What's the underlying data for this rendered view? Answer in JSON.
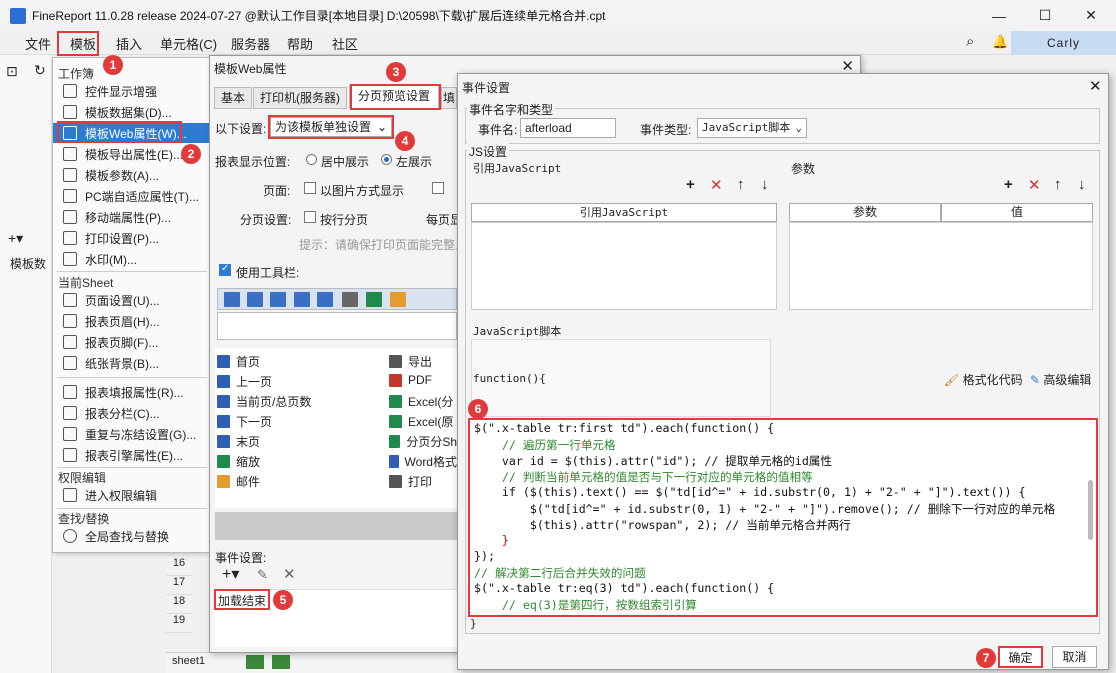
{
  "app": {
    "title": "FineReport 11.0.28 release 2024-07-27 @默认工作目录[本地目录]    D:\\20598\\下载\\扩展后连续单元格合并.cpt",
    "window_controls": [
      "—",
      "☐",
      "✕"
    ],
    "user": "Carly"
  },
  "menubar": [
    "文件",
    "模板",
    "插入",
    "单元格(C)",
    "服务器",
    "帮助",
    "社区"
  ],
  "left_panel": {
    "section": "模板数",
    "rows": [
      "16",
      "17",
      "18",
      "19"
    ],
    "sheet_tab": "sheet1"
  },
  "template_menu": {
    "sections": {
      "workbook": "工作簿",
      "current_sheet": "当前Sheet",
      "permission": "权限编辑",
      "find": "查找/替换"
    },
    "items_workbook": [
      "控件显示增强",
      "模板数据集(D)...",
      "模板Web属性(W)...",
      "模板导出属性(E)...",
      "模板参数(A)...",
      "PC端自适应属性(T)...",
      "移动端属性(P)...",
      "打印设置(P)...",
      "水印(M)..."
    ],
    "items_sheet": [
      "页面设置(U)...",
      "报表页眉(H)...",
      "报表页脚(F)...",
      "纸张背景(B)...",
      "报表填报属性(R)...",
      "报表分栏(C)...",
      "重复与冻结设置(G)...",
      "报表引擎属性(E)..."
    ],
    "items_permission": [
      "进入权限编辑"
    ],
    "items_find": [
      "全局查找与替换"
    ]
  },
  "web_dialog": {
    "title": "模板Web属性",
    "tabs": [
      "基本",
      "打印机(服务器)",
      "分页预览设置",
      "填"
    ],
    "settings_label": "以下设置:",
    "settings_value": "为该模板单独设置",
    "display_pos_label": "报表显示位置:",
    "center": "居中展示",
    "left": "左展示",
    "page_label": "页面:",
    "as_image": "以图片方式显示",
    "paging_label": "分页设置:",
    "by_row": "按行分页",
    "per_page": "每页显",
    "hint": "提示：请确保打印页面能完整显",
    "use_toolbar": "使用工具栏:",
    "buttons_left": [
      "首页",
      "上一页",
      "当前页/总页数",
      "下一页",
      "末页",
      "缩放",
      "邮件"
    ],
    "buttons_right": [
      "导出",
      "PDF",
      "Excel(分",
      "Excel(原",
      "分页分Sh",
      "Word格式",
      "打印"
    ],
    "event_label": "事件设置:",
    "event_item": "加载结束"
  },
  "event_dialog": {
    "title": "事件设置",
    "name_type_section": "事件名字和类型",
    "event_name_label": "事件名:",
    "event_name_value": "afterload",
    "event_type_label": "事件类型:",
    "event_type_value": "JavaScript脚本",
    "js_section": "JS设置",
    "ref_js_label": "引用JavaScript",
    "params_label": "参数",
    "ref_js_header": "引用JavaScript",
    "param_header": "参数",
    "value_header": "值",
    "script_label": "JavaScript脚本",
    "format_code": "格式化代码",
    "advanced_edit": "高级编辑",
    "func_open": "function(){",
    "code_lines": [
      "$(\".x-table tr:first td\").each(function() {",
      "    // 遍历第一行单元格",
      "    var id = $(this).attr(\"id\"); // 提取单元格的id属性",
      "    // 判断当前单元格的值是否与下一行对应的单元格的值相等",
      "    if ($(this).text() == $(\"td[id^=\" + id.substr(0, 1) + \"2-\" + \"]\").text()) {",
      "        $(\"td[id^=\" + id.substr(0, 1) + \"2-\" + \"]\").remove(); // 删除下一行对应的单元格",
      "        $(this).attr(\"rowspan\", 2); // 当前单元格合并两行",
      "    }",
      "});",
      "// 解决第二行后合并失效的问题",
      "$(\".x-table tr:eq(3) td\").each(function() {",
      "    // eq(3)是第四行，按数组索引引算"
    ],
    "func_close": "}",
    "ok": "确定",
    "cancel": "取消"
  },
  "callouts": [
    "1",
    "2",
    "3",
    "4",
    "5",
    "6",
    "7"
  ],
  "colors": {
    "accent": "#2e7bd3",
    "callout": "#e03a3a"
  }
}
